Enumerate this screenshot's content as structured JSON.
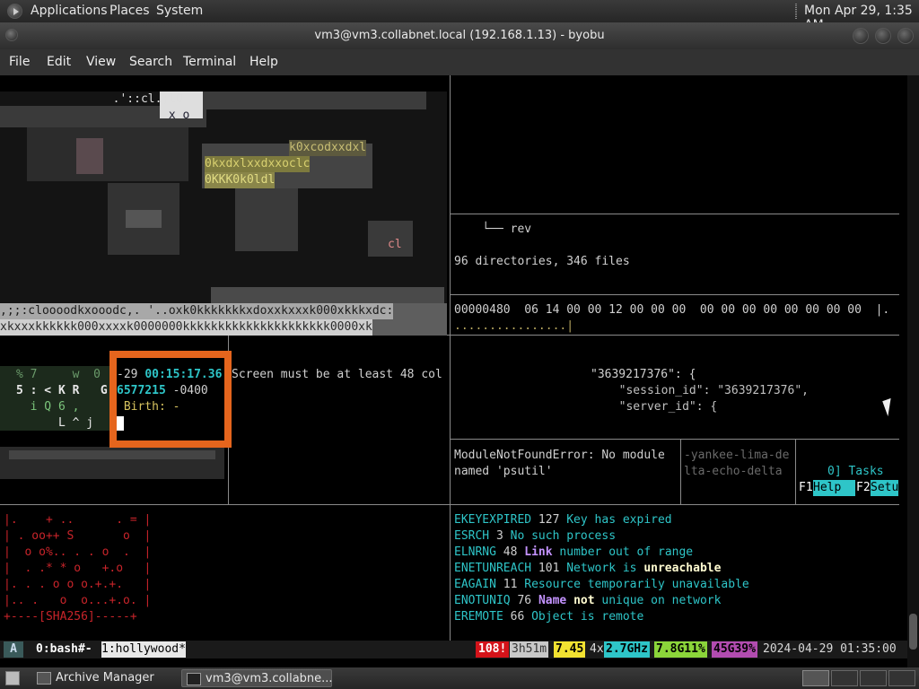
{
  "top_panel": {
    "menus": [
      "Applications",
      "Places",
      "System"
    ],
    "clock": "Mon Apr 29,  1:35 AM"
  },
  "window": {
    "title": "vm3@vm3.collabnet.local (192.168.1.13) - byobu"
  },
  "menubar": [
    "File",
    "Edit",
    "View",
    "Search",
    "Terminal",
    "Help"
  ],
  "panes": {
    "ascii_art": {
      "row1": "  .'::cl.;lO",
      "row2": " x o",
      "row3": "k0xcodxxdxl",
      "row4": "0kxdxlxxdxxoclc",
      "row5": "0KKK0k0ldl",
      "row6": "cl",
      "row7": ",;;:cloooodkxooodc,. '..oxk0kkkkkkkxdoxxkxxxk000xkkkxdc:",
      "row8": "xkxxxkkkkkk000xxxxk0000000kkkkkkkkkkkkkkkkkkkkk0000xk"
    },
    "tree": {
      "branch": "    └── rev",
      "summary": "96 directories, 346 files"
    },
    "hexdump": {
      "line": "00000480  06 14 00 00 12 00 00 00  00 00 00 00 00 00 00 00  |.",
      "tail": "................|"
    },
    "matrix": {
      "r1": "% 7     w  0",
      "r2": "5 : < K R   G",
      "r3": "  i Q 6 ,",
      "r4": "      L ^ j"
    },
    "stat": {
      "l1_dash": "-29 ",
      "l1_time": "00:15:17.36",
      "l2_num": "6577215",
      "l2_tz": " -0400",
      "l3": " Birth: -"
    },
    "screen_msg": "Screen must be at least 48 col",
    "json": {
      "l1": "\"3639217376\": {",
      "l2": "  \"session_id\": \"3639217376\",",
      "l3": "  \"server_id\": {"
    },
    "error": {
      "l1": "ModuleNotFoundError: No module",
      "l2": "named 'psutil'"
    },
    "codename": {
      "l1": "-yankee-lima-de",
      "l2": "lta-echo-delta"
    },
    "htop": {
      "tasks": "0] Tasks",
      "f1": "F1",
      "help": "Help  ",
      "f2": "F2",
      "setup": "Setu"
    },
    "randomart": {
      "r1": "|.    + ..      . = |",
      "r2": "| . oo++ S       o  |",
      "r3": "|  o o%.. . . o  .  |",
      "r4": "|  . .* * o   +.o   |",
      "r5": "|. . . o o o.+.+.   |",
      "r6": "|.. .   o  o...+.o. |",
      "r7": "+----[SHA256]-----+"
    },
    "errno": [
      {
        "name": "EKEYEXPIRED",
        "num": " 127 ",
        "d1": "Key has expired",
        "b": "",
        "d2": ""
      },
      {
        "name": "ESRCH",
        "num": " 3 ",
        "d1": "No such process",
        "b": "",
        "d2": ""
      },
      {
        "name": "ELNRNG",
        "num": " 48 ",
        "d1": "",
        "b": "Link",
        "d2": " number out of range"
      },
      {
        "name": "ENETUNREACH",
        "num": " 101 ",
        "d1": "Network is ",
        "b": "unreachable",
        "d2": ""
      },
      {
        "name": "EAGAIN",
        "num": " 11 ",
        "d1": "Resource temporarily unavailable",
        "b": "",
        "d2": ""
      },
      {
        "name": "ENOTUNIQ",
        "num": " 76 ",
        "d1": "",
        "b": "Name",
        "d2": ""
      },
      {
        "name": "EREMOTE",
        "num": " 66 ",
        "d1": "Object is remote",
        "b": "",
        "d2": ""
      }
    ],
    "enotuniq_not": "not",
    "enotuniq_rest": " unique on network"
  },
  "statusbar": {
    "logo": "A",
    "win0": "0:bash#-",
    "win1": "1:hollywood*",
    "updates": "108!",
    "uptime": "3h51m",
    "load": "7.45",
    "cpu_count": "4x",
    "cpu_freq": "2.7GHz",
    "mem": "7.8G11%",
    "disk": "45G39%",
    "datetime": "2024-04-29 01:35:00"
  },
  "taskbar": {
    "tasks": [
      "Archive Manager",
      "vm3@vm3.collabne..."
    ]
  },
  "colors": {
    "cyan": "#2ec5c8",
    "orange": "#e5651d",
    "red_status": "#d4131a",
    "yellow_status": "#f2e231",
    "green_status": "#8bd53a",
    "magenta_status": "#b24cb0"
  }
}
